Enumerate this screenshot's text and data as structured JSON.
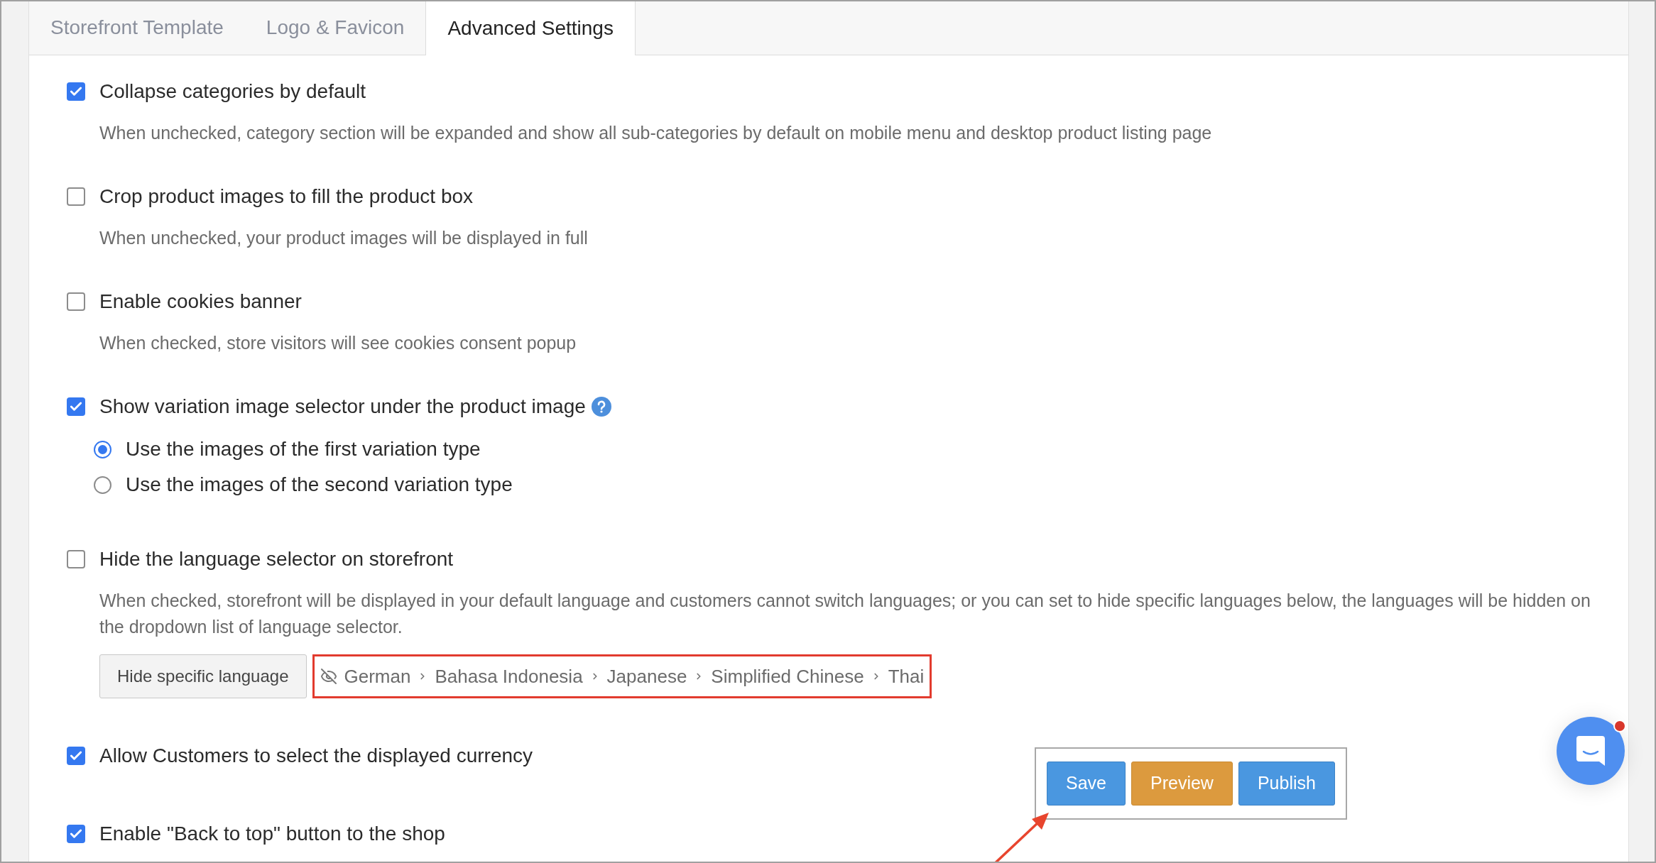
{
  "tabs": [
    {
      "label": "Storefront Template",
      "selected": false
    },
    {
      "label": "Logo & Favicon",
      "selected": false
    },
    {
      "label": "Advanced Settings",
      "selected": true
    }
  ],
  "settings": [
    {
      "kind": "checkbox",
      "label": "Collapse categories by default",
      "checked": true,
      "description": "When unchecked, category section will be expanded and show all sub-categories by default on mobile menu and desktop product listing page"
    },
    {
      "kind": "checkbox",
      "label": "Crop product images to fill the product box",
      "checked": false,
      "description": "When unchecked, your product images will be displayed in full"
    },
    {
      "kind": "checkbox",
      "label": "Enable cookies banner",
      "checked": false,
      "description": "When checked, store visitors will see cookies consent popup"
    },
    {
      "kind": "radio_group",
      "label": "Show variation image selector under the product image",
      "checked": true,
      "help": true,
      "options": [
        {
          "label": "Use the images of the first variation type",
          "selected": true
        },
        {
          "label": "Use the images of the second variation type",
          "selected": false
        }
      ]
    },
    {
      "kind": "language",
      "label": "Hide the language selector on storefront",
      "checked": false,
      "description": "When checked, storefront will be displayed in your default language and customers cannot switch languages; or you can set to hide specific languages below, the languages will be hidden on the dropdown list of language selector.",
      "button": "Hide specific language",
      "languages": [
        "German",
        "Bahasa Indonesia",
        "Japanese",
        "Simplified Chinese",
        "Thai"
      ]
    },
    {
      "kind": "checkbox",
      "label": "Allow Customers to select the displayed currency",
      "checked": true
    },
    {
      "kind": "checkbox",
      "label": "Enable \"Back to top\" button to the shop",
      "checked": true
    }
  ],
  "actions": [
    {
      "label": "Save",
      "kind": "primary"
    },
    {
      "label": "Preview",
      "kind": "warning"
    },
    {
      "label": "Publish",
      "kind": "primary"
    }
  ],
  "chat": {
    "unread": true
  }
}
